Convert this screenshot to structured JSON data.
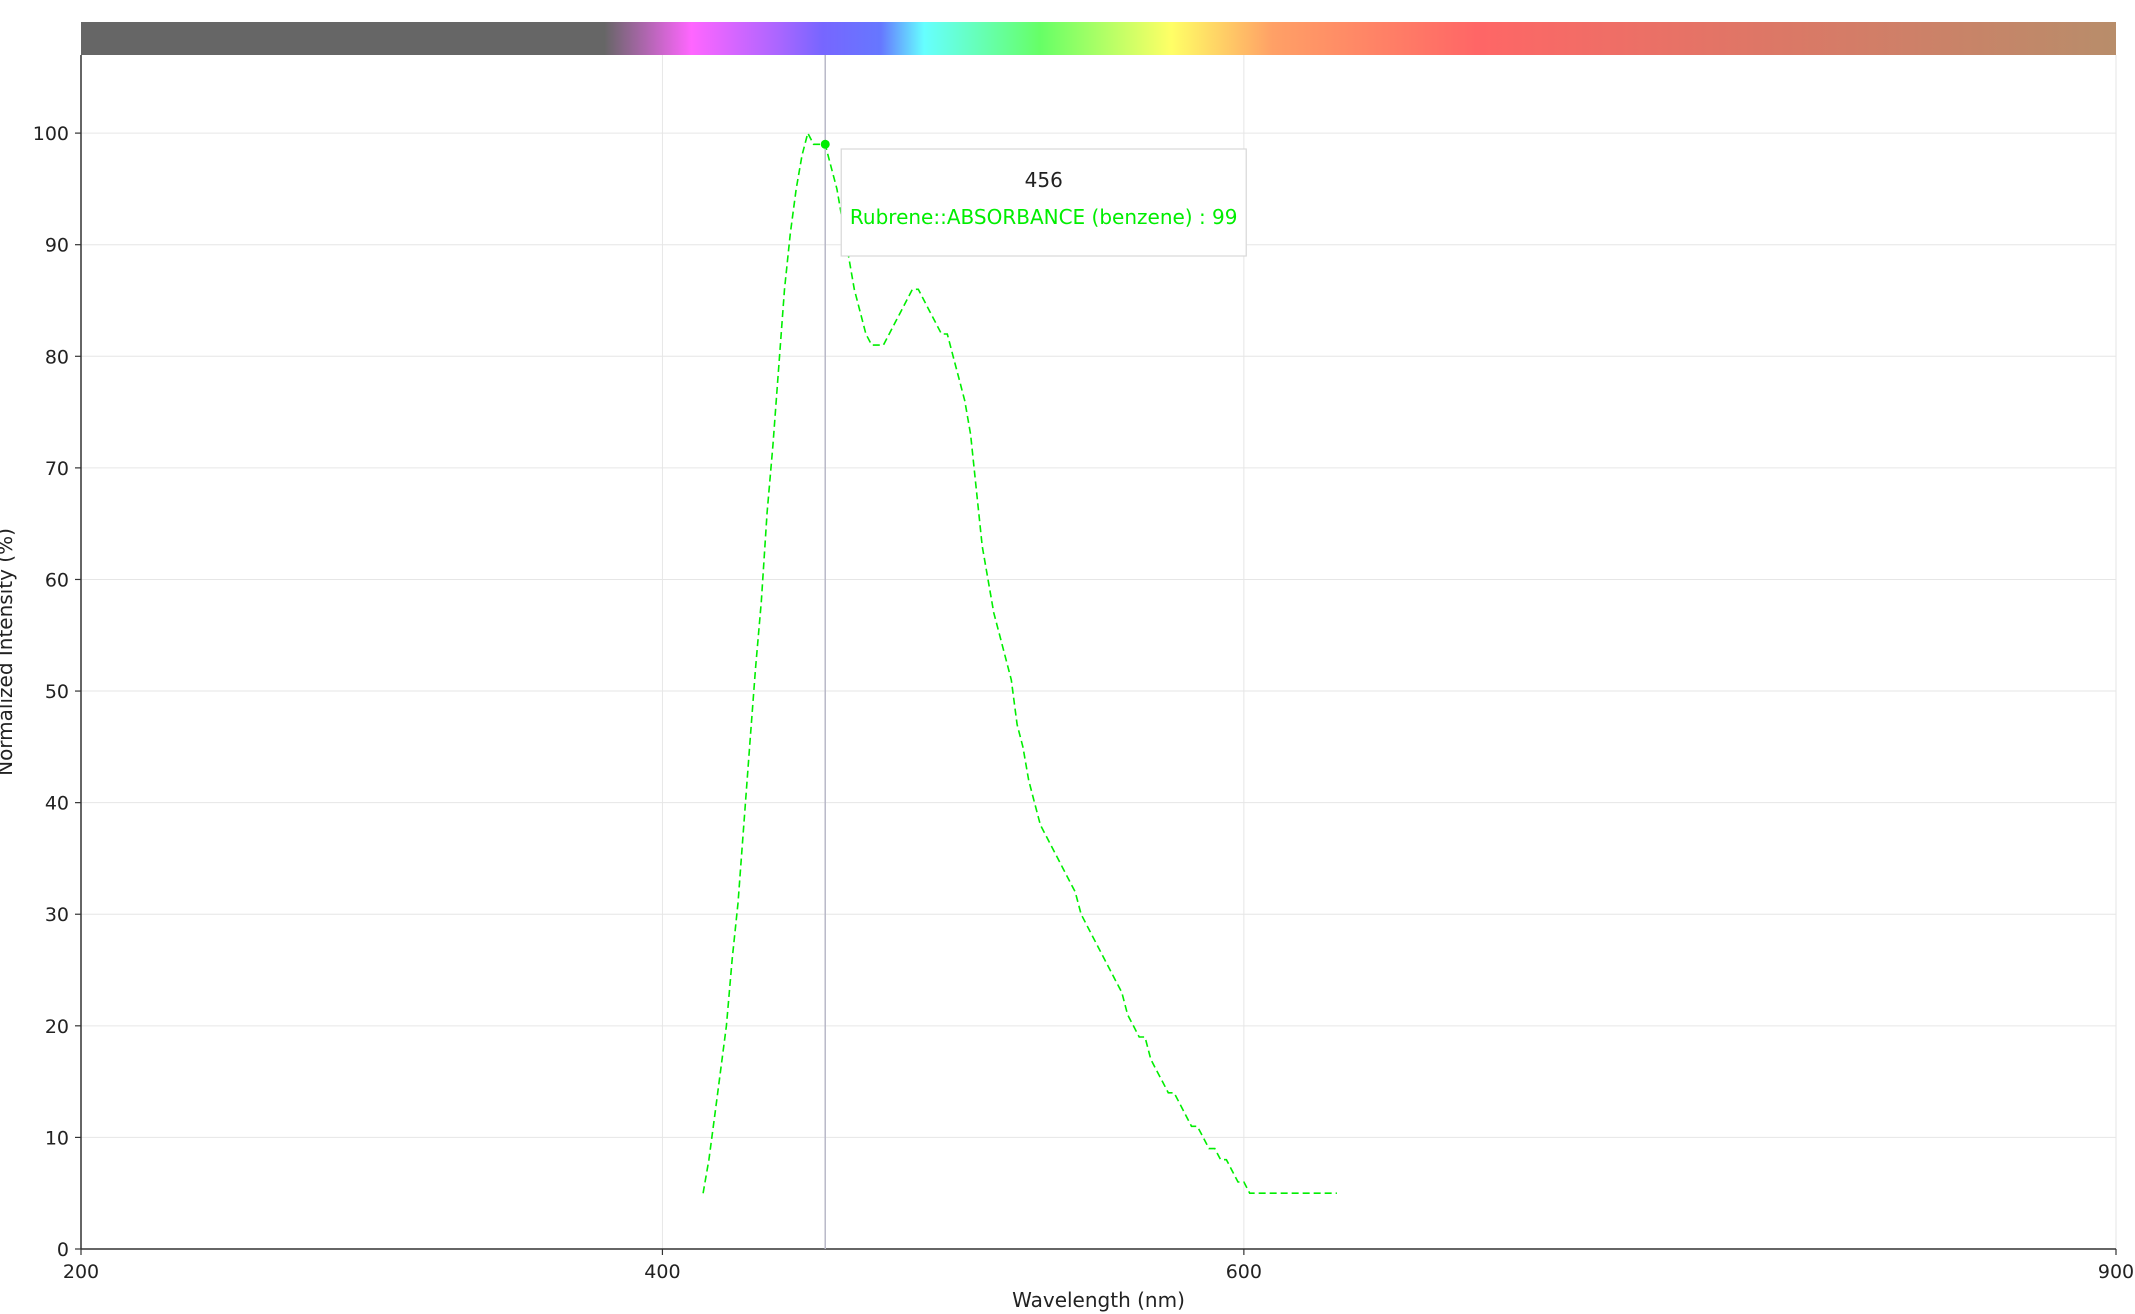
{
  "chart_data": {
    "type": "line",
    "xlabel": "Wavelength (nm)",
    "ylabel": "Normalized Intensity (%)",
    "xlim": [
      200,
      900
    ],
    "ylim": [
      0,
      107
    ],
    "x_ticks": [
      200,
      400,
      600,
      900
    ],
    "y_ticks": [
      0,
      10,
      20,
      30,
      40,
      50,
      60,
      70,
      80,
      90,
      100
    ],
    "grid": true,
    "spectrum_bar": {
      "stops": [
        {
          "nm": 200,
          "color": "#666666"
        },
        {
          "nm": 380,
          "color": "#666666"
        },
        {
          "nm": 400,
          "color": "#cc66cc"
        },
        {
          "nm": 410,
          "color": "#ff66ff"
        },
        {
          "nm": 440,
          "color": "#aa66ff"
        },
        {
          "nm": 455,
          "color": "#7766ff"
        },
        {
          "nm": 475,
          "color": "#6677ff"
        },
        {
          "nm": 490,
          "color": "#66ffff"
        },
        {
          "nm": 530,
          "color": "#66ff66"
        },
        {
          "nm": 575,
          "color": "#ffff66"
        },
        {
          "nm": 610,
          "color": "#ffa066"
        },
        {
          "nm": 680,
          "color": "#ff6666"
        },
        {
          "nm": 780,
          "color": "#dd7766"
        },
        {
          "nm": 900,
          "color": "#b88d6a"
        }
      ]
    },
    "series": [
      {
        "name": "Rubrene::ABSORBANCE (benzene)",
        "color": "#00ee00",
        "line_style": "dashed",
        "x": [
          414,
          416,
          418,
          420,
          422,
          424,
          426,
          428,
          430,
          432,
          434,
          436,
          438,
          440,
          442,
          444,
          446,
          448,
          450,
          452,
          454,
          456,
          458,
          460,
          462,
          464,
          466,
          468,
          470,
          472,
          474,
          476,
          478,
          480,
          482,
          484,
          486,
          488,
          490,
          492,
          494,
          496,
          498,
          500,
          502,
          504,
          506,
          508,
          510,
          512,
          514,
          516,
          518,
          520,
          522,
          524,
          526,
          528,
          530,
          532,
          534,
          536,
          538,
          540,
          542,
          544,
          546,
          548,
          550,
          552,
          554,
          556,
          558,
          560,
          562,
          564,
          566,
          568,
          570,
          572,
          574,
          576,
          578,
          580,
          582,
          584,
          586,
          588,
          590,
          592,
          594,
          596,
          598,
          600,
          602,
          604,
          606,
          608,
          610,
          612,
          614,
          616,
          618,
          620,
          622,
          624,
          626,
          628,
          630,
          632
        ],
        "y": [
          5,
          8,
          12,
          16,
          20,
          26,
          31,
          38,
          45,
          52,
          58,
          66,
          72,
          79,
          86,
          91,
          95,
          98,
          100,
          99,
          99,
          99,
          97,
          95,
          92,
          89,
          86,
          84,
          82,
          81,
          81,
          81,
          82,
          83,
          84,
          85,
          86,
          86,
          85,
          84,
          83,
          82,
          82,
          80,
          78,
          76,
          73,
          68,
          63,
          60,
          57,
          55,
          53,
          51,
          47,
          45,
          42,
          40,
          38,
          37,
          36,
          35,
          34,
          33,
          32,
          30,
          29,
          28,
          27,
          26,
          25,
          24,
          23,
          21,
          20,
          19,
          19,
          17,
          16,
          15,
          14,
          14,
          13,
          12,
          11,
          11,
          10,
          9,
          9,
          8,
          8,
          7,
          6,
          6,
          5,
          5,
          5,
          5,
          5,
          5,
          5,
          5,
          5,
          5,
          5,
          5,
          5,
          5,
          5,
          5
        ]
      }
    ],
    "hover": {
      "x": 456,
      "series": "Rubrene::ABSORBANCE (benzene)",
      "value": 99
    }
  },
  "tooltip": {
    "title": "456",
    "line": "Rubrene::ABSORBANCE (benzene) : 99"
  }
}
